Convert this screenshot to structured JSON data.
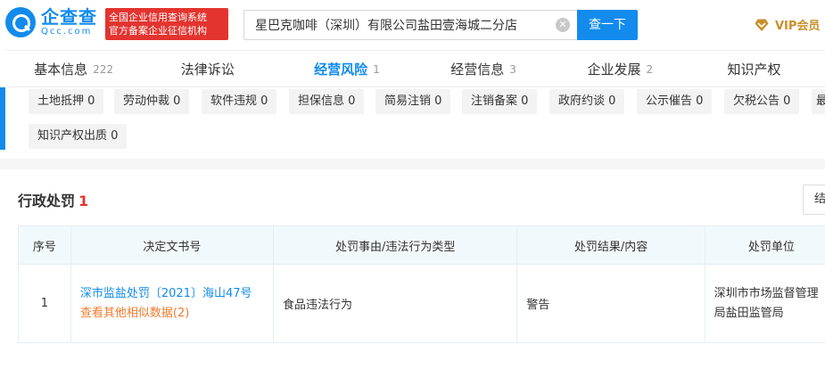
{
  "header": {
    "logo_main": "企查查",
    "logo_sub": "Qcc.com",
    "slogan_line1": "全国企业信用查询系统",
    "slogan_line2": "官方备案企业征信机构",
    "search_value": "星巴克咖啡（深圳）有限公司盐田壹海城二分店",
    "search_button": "查一下",
    "vip_label": "VIP会员"
  },
  "tabs": [
    {
      "label": "基本信息",
      "count": "222"
    },
    {
      "label": "法律诉讼",
      "count": ""
    },
    {
      "label": "经营风险",
      "count": "1"
    },
    {
      "label": "经营信息",
      "count": "3"
    },
    {
      "label": "企业发展",
      "count": "2"
    },
    {
      "label": "知识产权",
      "count": ""
    }
  ],
  "tags": [
    "土地抵押 0",
    "劳动仲裁 0",
    "软件违规 0",
    "担保信息 0",
    "简易注销 0",
    "注销备案 0",
    "政府约谈 0",
    "公示催告 0",
    "欠税公告 0",
    "知识产权出质 0"
  ],
  "section": {
    "title": "行政处罚",
    "count": "1",
    "button_label": "结"
  },
  "table": {
    "headers": [
      "序号",
      "决定文书号",
      "处罚事由/违法行为类型",
      "处罚结果/内容",
      "处罚单位"
    ],
    "rows": [
      {
        "index": "1",
        "doc_number": "深市监盐处罚〔2021〕海山47号",
        "other_link": "查看其他相似数据(2)",
        "reason": "食品违法行为",
        "result": "警告",
        "unit": "深圳市市场监督管理局盐田监管局"
      }
    ]
  },
  "colors": {
    "brand": "#128bed",
    "alert": "#e3342f",
    "vip": "#c8902c",
    "link_orange": "#f27b2c"
  }
}
